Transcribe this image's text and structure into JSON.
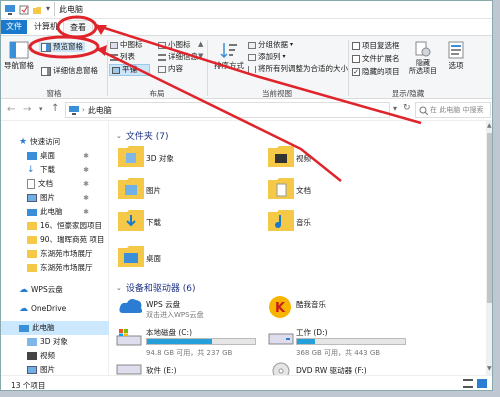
{
  "window": {
    "title": "此电脑",
    "breadcrumb": "此电脑",
    "search_placeholder": "在 此电脑 中搜索",
    "status": "13 个项目"
  },
  "menu": {
    "file": "文件",
    "computer": "计算机",
    "view": "查看"
  },
  "ribbon": {
    "nav_pane": "导航窗格",
    "preview_pane": "预览窗格",
    "details_pane": "详细信息窗格",
    "group_panes": "窗格",
    "medium_icons": "中图标",
    "small_icons": "小图标",
    "list": "列表",
    "details": "详细信息",
    "tiles": "平铺",
    "content": "内容",
    "group_layout": "布局",
    "sort_by": "排序方式",
    "group_by": "分组依据",
    "add_columns": "添加列",
    "size_all_columns": "将所有列调整为合适的大小",
    "group_current_view": "当前视图",
    "item_checkboxes": "项目复选框",
    "file_extensions": "文件扩展名",
    "hidden_items": "隐藏的项目",
    "hide_selected": "隐藏",
    "hide_selected_2": "所选项目",
    "options": "选项",
    "group_show_hide": "显示/隐藏"
  },
  "nav": {
    "items": [
      {
        "label": "快速访问",
        "icon": "star-icon"
      },
      {
        "label": "桌面",
        "icon": "desktop-folder-icon"
      },
      {
        "label": "下载",
        "icon": "download-folder-icon"
      },
      {
        "label": "文档",
        "icon": "document-folder-icon"
      },
      {
        "label": "图片",
        "icon": "picture-folder-icon"
      },
      {
        "label": "此电脑",
        "icon": "computer-icon"
      },
      {
        "label": "16、恒豪家园项目",
        "icon": "folder-icon"
      },
      {
        "label": "90、瑞晖商苑 项目",
        "icon": "folder-icon"
      },
      {
        "label": "东湖苑市场展厅",
        "icon": "folder-icon"
      },
      {
        "label": "东湖苑市场展厅",
        "icon": "folder-icon"
      },
      {
        "label": "WPS云盘",
        "icon": "cloud-icon"
      },
      {
        "label": "OneDrive",
        "icon": "onedrive-icon"
      },
      {
        "label": "此电脑",
        "icon": "computer-icon"
      },
      {
        "label": "3D 对象",
        "icon": "3d-objects-icon"
      },
      {
        "label": "视频",
        "icon": "video-folder-icon"
      },
      {
        "label": "图片",
        "icon": "picture-folder-icon"
      }
    ]
  },
  "sections": {
    "folders": "文件夹 (7)",
    "devices": "设备和驱动器 (6)"
  },
  "folders": [
    {
      "label": "3D 对象",
      "icon": "3d-objects-icon"
    },
    {
      "label": "视频",
      "icon": "video-folder-icon"
    },
    {
      "label": "图片",
      "icon": "picture-folder-icon"
    },
    {
      "label": "文档",
      "icon": "document-folder-icon"
    },
    {
      "label": "下载",
      "icon": "download-folder-icon"
    },
    {
      "label": "音乐",
      "icon": "music-folder-icon"
    },
    {
      "label": "桌面",
      "icon": "desktop-folder-icon"
    }
  ],
  "devices": [
    {
      "label": "WPS 云盘",
      "sub": "双击进入WPS云盘",
      "icon": "wps-cloud-icon"
    },
    {
      "label": "酷我音乐",
      "sub": "",
      "icon": "kuwo-music-icon"
    },
    {
      "label": "本地磁盘 (C:)",
      "sub": "94.8 GB 可用，共 237 GB",
      "fill": 0.6,
      "icon": "drive-c-icon"
    },
    {
      "label": "工作 (D:)",
      "sub": "368 GB 可用，共 443 GB",
      "fill": 0.17,
      "icon": "drive-d-icon"
    },
    {
      "label": "软件 (E:)",
      "sub": "",
      "icon": "drive-e-icon"
    },
    {
      "label": "DVD RW 驱动器 (F:)",
      "sub": "",
      "icon": "dvd-drive-icon"
    }
  ],
  "colors": {
    "accent": "#1979ca",
    "annotation": "#e0242b",
    "folder": "#f5c947"
  }
}
